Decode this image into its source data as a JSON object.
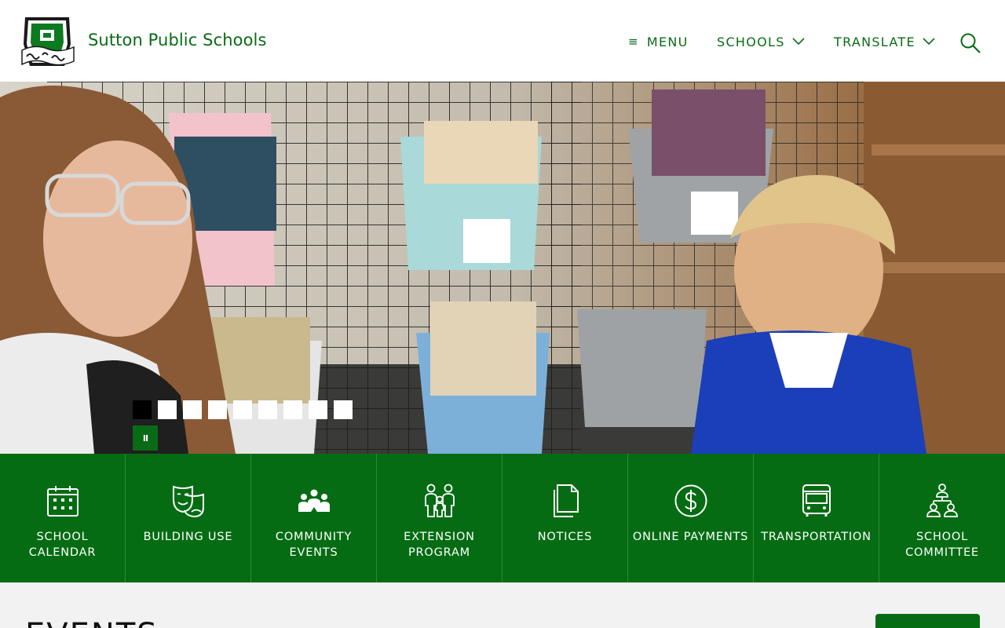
{
  "header": {
    "site_title": "Sutton Public Schools",
    "logo_alt": "Sammies & Suzies",
    "nav": [
      {
        "label": "MENU",
        "icon": "hamburger-icon"
      },
      {
        "label": "SCHOOLS",
        "icon": "chevron-down-icon"
      },
      {
        "label": "TRANSLATE",
        "icon": "chevron-down-icon"
      }
    ],
    "search_icon": "search-icon"
  },
  "hero": {
    "slide_count": 9,
    "active_slide": 1,
    "pause_label": "II"
  },
  "quicklinks": [
    {
      "label": "SCHOOL CALENDAR",
      "icon": "calendar-icon"
    },
    {
      "label": "BUILDING USE",
      "icon": "theater-masks-icon"
    },
    {
      "label": "COMMUNITY EVENTS",
      "icon": "people-group-icon"
    },
    {
      "label": "EXTENSION PROGRAM",
      "icon": "family-icon"
    },
    {
      "label": "NOTICES",
      "icon": "document-icon"
    },
    {
      "label": "ONLINE PAYMENTS",
      "icon": "dollar-circle-icon"
    },
    {
      "label": "TRANSPORTATION",
      "icon": "bus-icon"
    },
    {
      "label": "SCHOOL COMMITTEE",
      "icon": "org-chart-icon"
    }
  ],
  "events": {
    "title": "EVENTS"
  },
  "colors": {
    "brand_green": "#066c13",
    "title_green": "#0a6b16",
    "background": "#f2f2f2"
  }
}
